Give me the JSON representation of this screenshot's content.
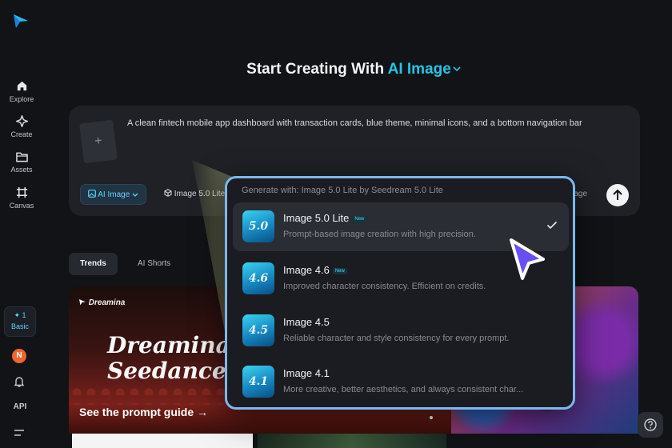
{
  "app": {
    "brand_color": "#22c6e8",
    "accent_blue": "#5fd3ff"
  },
  "sidebar": {
    "items": [
      {
        "label": "Explore",
        "icon": "home-icon"
      },
      {
        "label": "Create",
        "icon": "sparkle-icon"
      },
      {
        "label": "Assets",
        "icon": "folder-icon"
      },
      {
        "label": "Canvas",
        "icon": "canvas-icon"
      }
    ],
    "plan": {
      "credits": "✦ 1",
      "name": "Basic"
    },
    "avatar_initial": "N",
    "api_label": "API"
  },
  "headline": {
    "prefix": "Start Creating With",
    "mode": "AI Image"
  },
  "prompt": {
    "text": "A clean fintech mobile app dashboard with transaction cards, blue theme, minimal icons, and a bottom navigation bar",
    "add_reference": "+",
    "mode_chip": "AI Image",
    "model_chip": "Image 5.0 Lite",
    "partial_chip": "mage"
  },
  "tabs": [
    {
      "label": "Trends",
      "active": true
    },
    {
      "label": "AI Shorts",
      "active": false
    }
  ],
  "banner": {
    "brand": "Dreamina",
    "headline_line1": "Dreamina",
    "headline_line2": "Seedance 2.",
    "cta": "See the prompt guide →"
  },
  "dropdown": {
    "header": "Generate with: Image 5.0 Lite by Seedream 5.0 Lite",
    "options": [
      {
        "badge": "5.0",
        "title": "Image 5.0 Lite",
        "new": "New",
        "desc": "Prompt-based image creation with high precision.",
        "selected": true
      },
      {
        "badge": "4.6",
        "title": "Image 4.6",
        "new": "New",
        "desc": "Improved character consistency. Efficient on credits.",
        "selected": false
      },
      {
        "badge": "4.5",
        "title": "Image 4.5",
        "new": "",
        "desc": "Reliable character and style consistency for every prompt.",
        "selected": false
      },
      {
        "badge": "4.1",
        "title": "Image 4.1",
        "new": "",
        "desc": "More creative, better aesthetics, and always consistent char...",
        "selected": false
      }
    ]
  }
}
